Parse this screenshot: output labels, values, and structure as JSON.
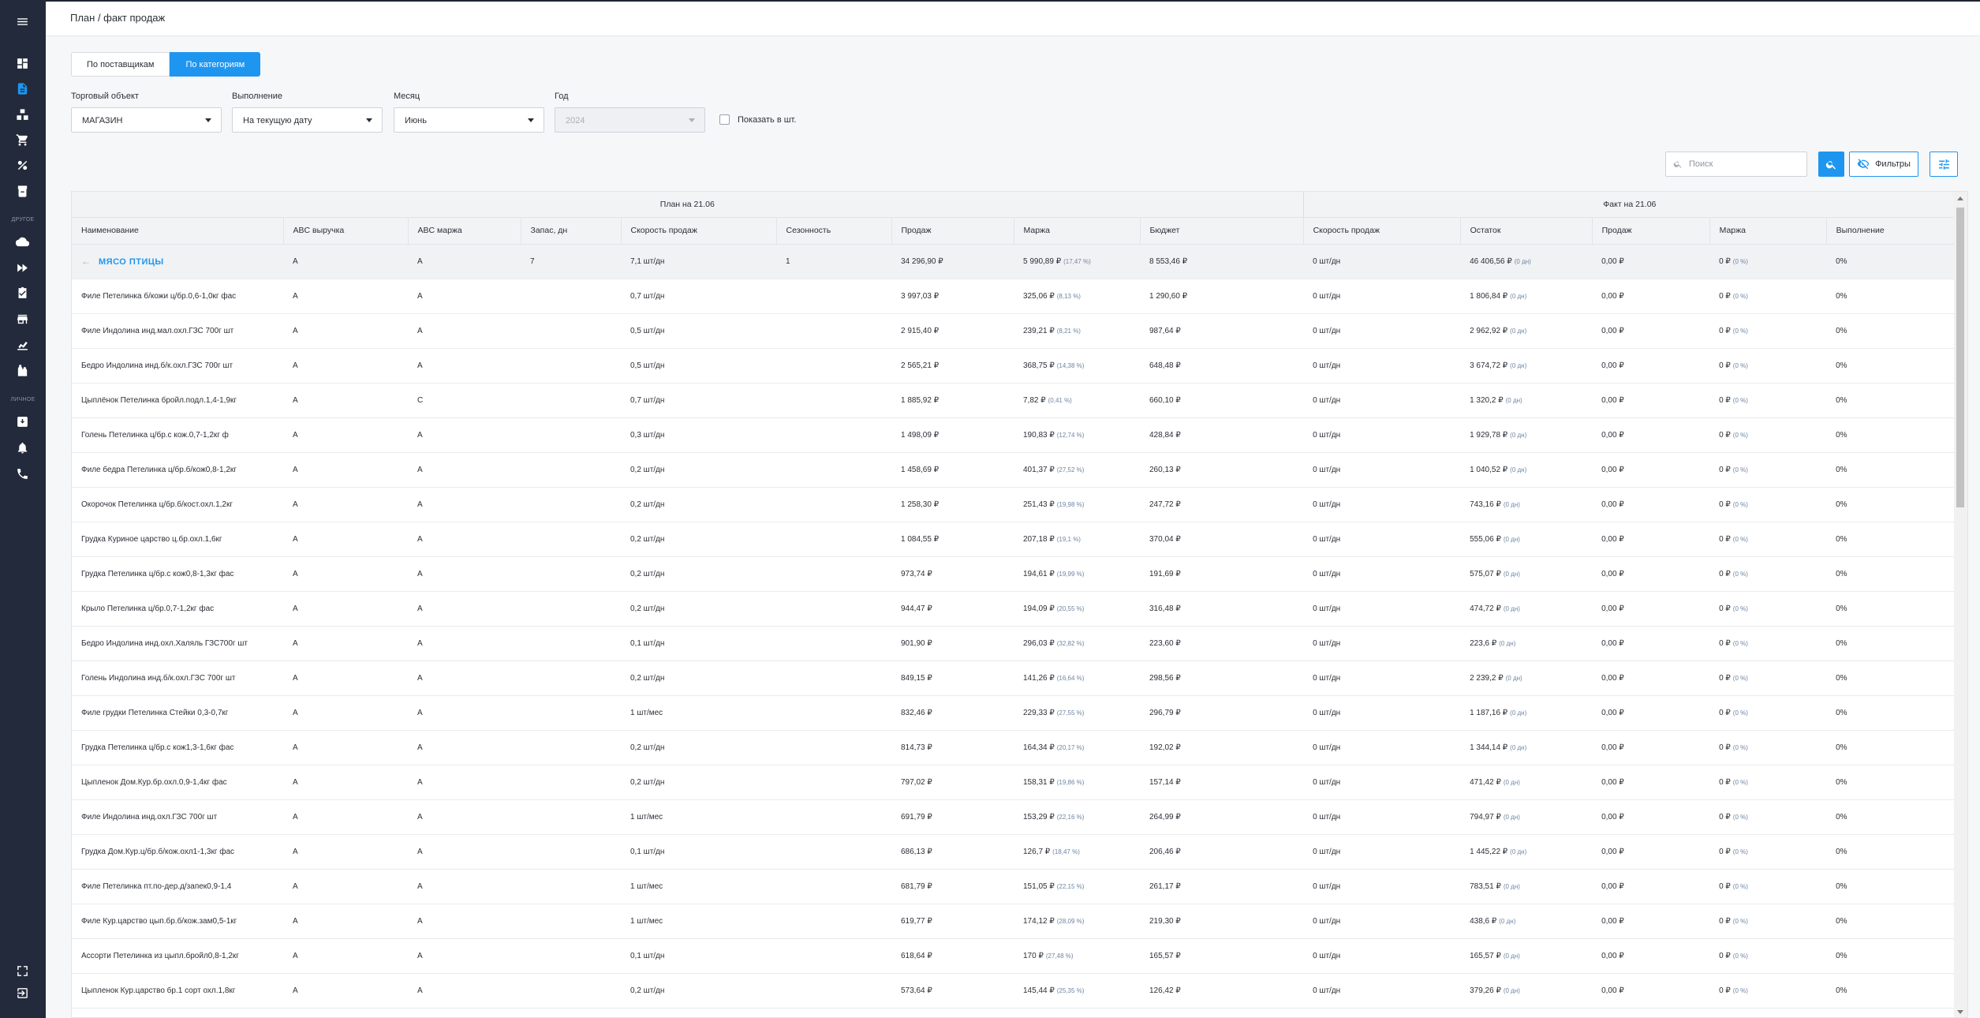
{
  "sidebar": {
    "caption_other": "ДРУГОЕ",
    "caption_personal": "ЛИЧНОЕ"
  },
  "header": {
    "title": "План / факт продаж"
  },
  "view_toggle": {
    "suppliers": "По поставщикам",
    "categories": "По категориям",
    "active": "categories"
  },
  "filters": {
    "store": {
      "label": "Торговый объект",
      "value": "МАГАЗИН"
    },
    "execution": {
      "label": "Выполнение",
      "value": "На текущую дату"
    },
    "month": {
      "label": "Месяц",
      "value": "Июнь"
    },
    "year": {
      "label": "Год",
      "value": "2024"
    },
    "show_pieces": {
      "label": "Показать в шт.",
      "checked": false
    }
  },
  "toolbar": {
    "search_placeholder": "Поиск",
    "filters_label": "Фильтры"
  },
  "table": {
    "group_plan": "План на 21.06",
    "group_fact": "Факт на 21.06",
    "columns": [
      "Наименование",
      "ABC выручка",
      "ABC маржа",
      "Запас, дн",
      "Скорость продаж",
      "Сезонность",
      "Продаж",
      "Маржа",
      "Бюджет",
      "Скорость продаж",
      "Остаток",
      "Продаж",
      "Маржа",
      "Выполнение"
    ],
    "category": {
      "name": "МЯСО ПТИЦЫ",
      "abc_rev": "A",
      "abc_margin": "A",
      "stock_days": "7",
      "speed": "7,1 шт/дн",
      "season": "1",
      "sales": "34 296,90 ₽",
      "margin": "5 990,89 ₽",
      "margin_pct": "(17,47 %)",
      "budget": "8 553,46 ₽",
      "f_speed": "0 шт/дн",
      "f_rest": "46 406,56 ₽",
      "f_rest_days": "(0 дн)",
      "f_sales": "0,00 ₽",
      "f_margin": "0 ₽",
      "f_margin_pct": "(0 %)",
      "f_exec": "0%"
    },
    "rows": [
      {
        "name": "Филе Петелинка б/кожи ц/бр.0,6-1,0кг фас",
        "abc_rev": "A",
        "abc_margin": "A",
        "speed": "0,7 шт/дн",
        "sales": "3 997,03 ₽",
        "margin": "325,06 ₽",
        "margin_pct": "(8,13 %)",
        "budget": "1 290,60 ₽",
        "f_rest": "1 806,84 ₽"
      },
      {
        "name": "Филе Индолина инд.мал.охл.ГЗС 700г шт",
        "abc_rev": "A",
        "abc_margin": "A",
        "speed": "0,5 шт/дн",
        "sales": "2 915,40 ₽",
        "margin": "239,21 ₽",
        "margin_pct": "(8,21 %)",
        "budget": "987,64 ₽",
        "f_rest": "2 962,92 ₽"
      },
      {
        "name": "Бедро Индолина инд.б/к.охл.ГЗС 700г шт",
        "abc_rev": "A",
        "abc_margin": "A",
        "speed": "0,5 шт/дн",
        "sales": "2 565,21 ₽",
        "margin": "368,75 ₽",
        "margin_pct": "(14,38 %)",
        "budget": "648,48 ₽",
        "f_rest": "3 674,72 ₽"
      },
      {
        "name": "Цыплёнок Петелинка бройл.подл.1,4-1,9кг",
        "abc_rev": "A",
        "abc_margin": "C",
        "speed": "0,7 шт/дн",
        "sales": "1 885,92 ₽",
        "margin": "7,82 ₽",
        "margin_pct": "(0,41 %)",
        "budget": "660,10 ₽",
        "f_rest": "1 320,2 ₽"
      },
      {
        "name": "Голень Петелинка ц/бр.с кож.0,7-1,2кг ф",
        "abc_rev": "A",
        "abc_margin": "A",
        "speed": "0,3 шт/дн",
        "sales": "1 498,09 ₽",
        "margin": "190,83 ₽",
        "margin_pct": "(12,74 %)",
        "budget": "428,84 ₽",
        "f_rest": "1 929,78 ₽"
      },
      {
        "name": "Филе бедра Петелинка ц/бр.б/кож0,8-1,2кг",
        "abc_rev": "A",
        "abc_margin": "A",
        "speed": "0,2 шт/дн",
        "sales": "1 458,69 ₽",
        "margin": "401,37 ₽",
        "margin_pct": "(27,52 %)",
        "budget": "260,13 ₽",
        "f_rest": "1 040,52 ₽"
      },
      {
        "name": "Окорочок Петелинка ц/бр.б/кост.охл.1,2кг",
        "abc_rev": "A",
        "abc_margin": "A",
        "speed": "0,2 шт/дн",
        "sales": "1 258,30 ₽",
        "margin": "251,43 ₽",
        "margin_pct": "(19,98 %)",
        "budget": "247,72 ₽",
        "f_rest": "743,16 ₽"
      },
      {
        "name": "Грудка Куриное царство ц.бр.охл.1,6кг",
        "abc_rev": "A",
        "abc_margin": "A",
        "speed": "0,2 шт/дн",
        "sales": "1 084,55 ₽",
        "margin": "207,18 ₽",
        "margin_pct": "(19,1 %)",
        "budget": "370,04 ₽",
        "f_rest": "555,06 ₽"
      },
      {
        "name": "Грудка Петелинка ц/бр.с кож0,8-1,3кг фас",
        "abc_rev": "A",
        "abc_margin": "A",
        "speed": "0,2 шт/дн",
        "sales": "973,74 ₽",
        "margin": "194,61 ₽",
        "margin_pct": "(19,99 %)",
        "budget": "191,69 ₽",
        "f_rest": "575,07 ₽"
      },
      {
        "name": "Крыло Петелинка ц/бр.0,7-1,2кг фас",
        "abc_rev": "A",
        "abc_margin": "A",
        "speed": "0,2 шт/дн",
        "sales": "944,47 ₽",
        "margin": "194,09 ₽",
        "margin_pct": "(20,55 %)",
        "budget": "316,48 ₽",
        "f_rest": "474,72 ₽"
      },
      {
        "name": "Бедро Индолина инд.охл.Халяль ГЗС700г шт",
        "abc_rev": "A",
        "abc_margin": "A",
        "speed": "0,1 шт/дн",
        "sales": "901,90 ₽",
        "margin": "296,03 ₽",
        "margin_pct": "(32,82 %)",
        "budget": "223,60 ₽",
        "f_rest": "223,6 ₽"
      },
      {
        "name": "Голень Индолина инд.б/к.охл.ГЗС 700г шт",
        "abc_rev": "A",
        "abc_margin": "A",
        "speed": "0,2 шт/дн",
        "sales": "849,15 ₽",
        "margin": "141,26 ₽",
        "margin_pct": "(16,64 %)",
        "budget": "298,56 ₽",
        "f_rest": "2 239,2 ₽"
      },
      {
        "name": "Филе грудки Петелинка Стейки 0,3-0,7кг",
        "abc_rev": "A",
        "abc_margin": "A",
        "speed": "1 шт/мес",
        "sales": "832,46 ₽",
        "margin": "229,33 ₽",
        "margin_pct": "(27,55 %)",
        "budget": "296,79 ₽",
        "f_rest": "1 187,16 ₽"
      },
      {
        "name": "Грудка Петелинка ц/бр.с кож1,3-1,6кг фас",
        "abc_rev": "A",
        "abc_margin": "A",
        "speed": "0,2 шт/дн",
        "sales": "814,73 ₽",
        "margin": "164,34 ₽",
        "margin_pct": "(20,17 %)",
        "budget": "192,02 ₽",
        "f_rest": "1 344,14 ₽"
      },
      {
        "name": "Цыпленок Дом.Кур.бр.охл.0,9-1,4кг фас",
        "abc_rev": "A",
        "abc_margin": "A",
        "speed": "0,2 шт/дн",
        "sales": "797,02 ₽",
        "margin": "158,31 ₽",
        "margin_pct": "(19,86 %)",
        "budget": "157,14 ₽",
        "f_rest": "471,42 ₽"
      },
      {
        "name": "Филе Индолина инд.охл.ГЗС 700г шт",
        "abc_rev": "A",
        "abc_margin": "A",
        "speed": "1 шт/мес",
        "sales": "691,79 ₽",
        "margin": "153,29 ₽",
        "margin_pct": "(22,16 %)",
        "budget": "264,99 ₽",
        "f_rest": "794,97 ₽"
      },
      {
        "name": "Грудка Дом.Кур.ц/бр.б/кож.охл1-1,3кг фас",
        "abc_rev": "A",
        "abc_margin": "A",
        "speed": "0,1 шт/дн",
        "sales": "686,13 ₽",
        "margin": "126,7 ₽",
        "margin_pct": "(18,47 %)",
        "budget": "206,46 ₽",
        "f_rest": "1 445,22 ₽"
      },
      {
        "name": "Филе Петелинка пт.по-дер.д/запек0,9-1,4",
        "abc_rev": "A",
        "abc_margin": "A",
        "speed": "1 шт/мес",
        "sales": "681,79 ₽",
        "margin": "151,05 ₽",
        "margin_pct": "(22,15 %)",
        "budget": "261,17 ₽",
        "f_rest": "783,51 ₽"
      },
      {
        "name": "Филе Кур.царство цып.бр.б/кож.зам0,5-1кг",
        "abc_rev": "A",
        "abc_margin": "A",
        "speed": "1 шт/мес",
        "sales": "619,77 ₽",
        "margin": "174,12 ₽",
        "margin_pct": "(28,09 %)",
        "budget": "219,30 ₽",
        "f_rest": "438,6 ₽"
      },
      {
        "name": "Ассорти Петелинка из цыпл.бройл0,8-1,2кг",
        "abc_rev": "A",
        "abc_margin": "A",
        "speed": "0,1 шт/дн",
        "sales": "618,64 ₽",
        "margin": "170 ₽",
        "margin_pct": "(27,48 %)",
        "budget": "165,57 ₽",
        "f_rest": "165,57 ₽"
      },
      {
        "name": "Цыпленок Кур.царство бр.1 сорт охл.1,8кг",
        "abc_rev": "A",
        "abc_margin": "A",
        "speed": "0,2 шт/дн",
        "sales": "573,64 ₽",
        "margin": "145,44 ₽",
        "margin_pct": "(25,35 %)",
        "budget": "126,42 ₽",
        "f_rest": "379,26 ₽"
      }
    ],
    "fact_defaults": {
      "speed": "0 шт/дн",
      "rest_days": "(0 дн)",
      "sales": "0,00 ₽",
      "margin": "0 ₽",
      "margin_pct": "(0 %)",
      "exec": "0%"
    }
  }
}
